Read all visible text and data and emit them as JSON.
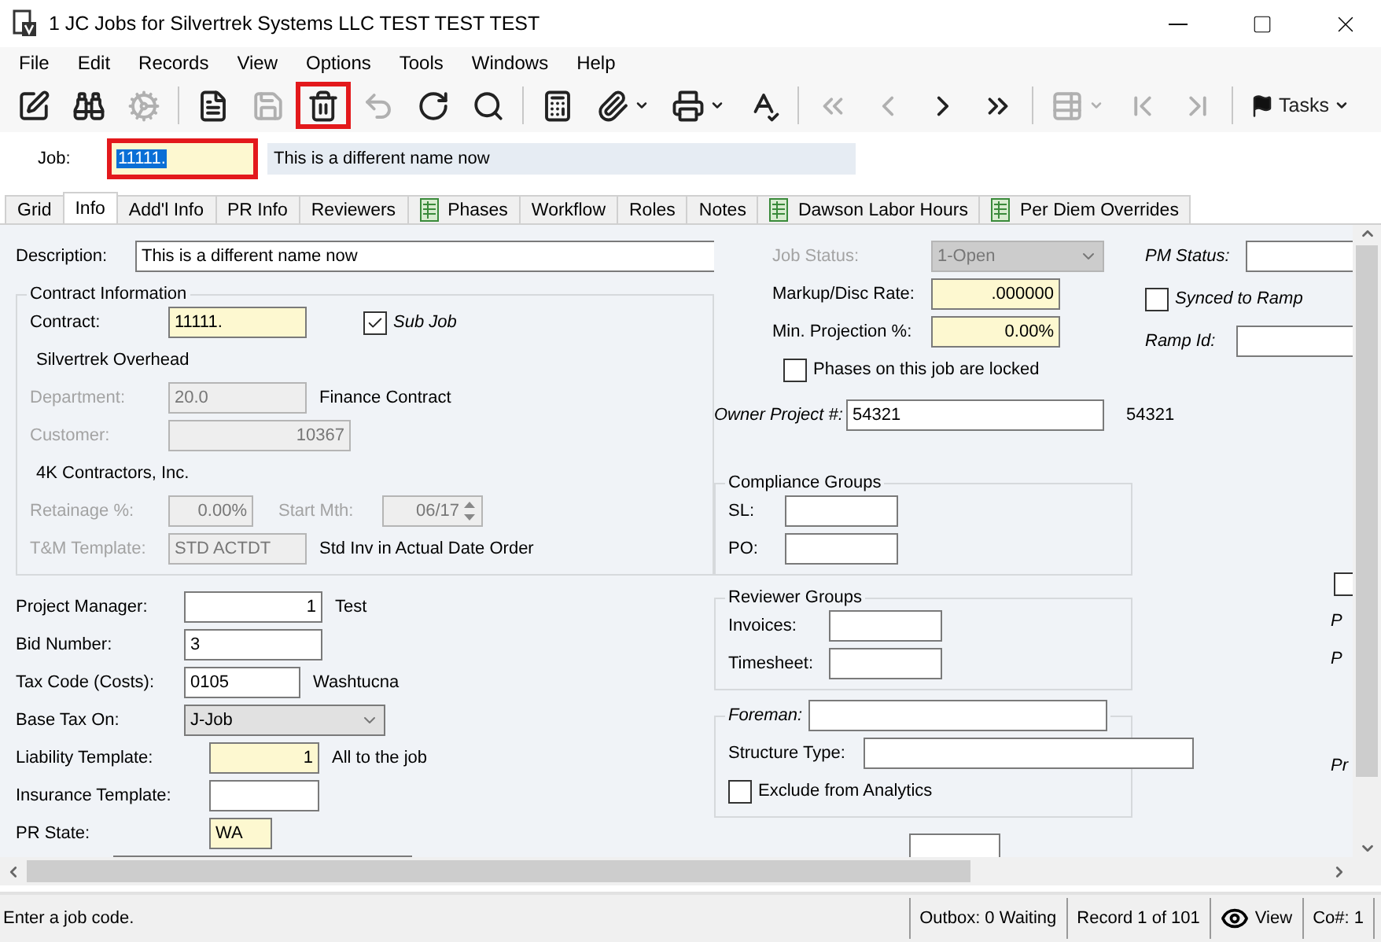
{
  "window": {
    "title": "1 JC Jobs for Silvertrek Systems LLC TEST TEST TEST"
  },
  "menu": [
    "File",
    "Edit",
    "Records",
    "View",
    "Options",
    "Tools",
    "Windows",
    "Help"
  ],
  "toolbar": [
    {
      "kind": "button",
      "disabled": false,
      "highlighted": false,
      "dropdown": false
    },
    {
      "kind": "button",
      "disabled": false,
      "highlighted": false,
      "dropdown": false
    },
    {
      "kind": "button",
      "disabled": true,
      "highlighted": false,
      "dropdown": false
    },
    {
      "kind": "separator"
    },
    {
      "kind": "button",
      "disabled": false,
      "highlighted": false,
      "dropdown": false
    },
    {
      "kind": "button",
      "disabled": true,
      "highlighted": false,
      "dropdown": false
    },
    {
      "kind": "button",
      "disabled": false,
      "highlighted": true,
      "dropdown": false
    },
    {
      "kind": "button",
      "disabled": true,
      "highlighted": false,
      "dropdown": false
    },
    {
      "kind": "button",
      "disabled": false,
      "highlighted": false,
      "dropdown": false
    },
    {
      "kind": "button",
      "disabled": false,
      "highlighted": false,
      "dropdown": false
    },
    {
      "kind": "separator"
    },
    {
      "kind": "button",
      "disabled": false,
      "highlighted": false,
      "dropdown": false
    },
    {
      "kind": "button",
      "disabled": false,
      "highlighted": false,
      "dropdown": true
    },
    {
      "kind": "button",
      "disabled": false,
      "highlighted": false,
      "dropdown": true
    },
    {
      "kind": "button",
      "disabled": false,
      "highlighted": false,
      "dropdown": false
    },
    {
      "kind": "separator"
    },
    {
      "kind": "button",
      "disabled": true,
      "highlighted": false,
      "dropdown": false
    },
    {
      "kind": "button",
      "disabled": true,
      "highlighted": false,
      "dropdown": false
    },
    {
      "kind": "button",
      "disabled": false,
      "highlighted": false,
      "dropdown": false
    },
    {
      "kind": "button",
      "disabled": false,
      "highlighted": false,
      "dropdown": false
    },
    {
      "kind": "separator"
    },
    {
      "kind": "button",
      "disabled": true,
      "highlighted": false,
      "dropdown": true
    },
    {
      "kind": "button",
      "disabled": true,
      "highlighted": false,
      "dropdown": false
    },
    {
      "kind": "button",
      "disabled": true,
      "highlighted": false,
      "dropdown": false
    },
    {
      "kind": "separator"
    },
    {
      "kind": "menu",
      "label": "Tasks",
      "dropdown": true
    }
  ],
  "job": {
    "label": "Job:",
    "value": "11111.",
    "text_selected": true,
    "highlighted": true,
    "name": "This is a different name now"
  },
  "tabs": [
    {
      "label": "Grid",
      "selected": false,
      "kind": "plain"
    },
    {
      "label": "Info",
      "selected": true,
      "kind": "plain"
    },
    {
      "label": "Add'l Info",
      "selected": false,
      "kind": "plain"
    },
    {
      "label": "PR Info",
      "selected": false,
      "kind": "plain"
    },
    {
      "label": "Reviewers",
      "selected": false,
      "kind": "plain"
    },
    {
      "label": "Phases",
      "selected": false,
      "kind": "grid"
    },
    {
      "label": "Workflow",
      "selected": false,
      "kind": "plain"
    },
    {
      "label": "Roles",
      "selected": false,
      "kind": "plain"
    },
    {
      "label": "Notes",
      "selected": false,
      "kind": "plain"
    },
    {
      "label": "Dawson Labor Hours",
      "selected": false,
      "kind": "grid"
    },
    {
      "label": "Per Diem Overrides",
      "selected": false,
      "kind": "grid"
    }
  ],
  "form": {
    "description": {
      "label": "Description:",
      "value": "This is a different name now",
      "kind": "text"
    },
    "contract_group": {
      "title": "Contract Information",
      "contract": {
        "label": "Contract:",
        "value": "11111.",
        "kind": "required"
      },
      "sub_job": {
        "label": "Sub Job",
        "checked": true
      },
      "contract_name": "Silvertrek Overhead",
      "department": {
        "label": "Department:",
        "value": "20.0",
        "kind": "readonly",
        "disabled": true,
        "note": "Finance Contract"
      },
      "customer": {
        "label": "Customer:",
        "value": "10367",
        "kind": "readonly",
        "disabled": true
      },
      "customer_name": "4K Contractors, Inc.",
      "retainage": {
        "label": "Retainage %:",
        "value": "0.00%",
        "kind": "readonly",
        "disabled": true
      },
      "start_month": {
        "label": "Start Mth:",
        "value": "06/17",
        "kind": "spinner",
        "disabled": true
      },
      "tm_template": {
        "label": "T&M Template:",
        "value": "STD ACTDT",
        "kind": "readonly",
        "disabled": true,
        "note": "Std Inv in Actual Date Order"
      }
    },
    "details": [
      {
        "label": "Project Manager:",
        "value": "1",
        "kind": "text",
        "note": "Test"
      },
      {
        "label": "Bid Number:",
        "value": "3",
        "kind": "text"
      },
      {
        "label": "Tax Code (Costs):",
        "value": "0105",
        "kind": "text",
        "note": "Washtucna"
      },
      {
        "label": "Base Tax On:",
        "value": "J-Job",
        "kind": "select"
      },
      {
        "label": "Liability Template:",
        "value": "1",
        "kind": "required",
        "note": "All to the job"
      },
      {
        "label": "Insurance Template:",
        "kind": "text"
      },
      {
        "label": "PR State:",
        "value": "WA",
        "kind": "required"
      }
    ],
    "partial_field": {
      "kind": "text"
    },
    "job_status": {
      "label": "Job Status:",
      "value": "1-Open",
      "kind": "select",
      "disabled": true
    },
    "markup_rate": {
      "label": "Markup/Disc Rate:",
      "value": ".000000",
      "kind": "required"
    },
    "min_projection": {
      "label": "Min. Projection %:",
      "value": "0.00%",
      "kind": "required"
    },
    "phases_locked": {
      "label": "Phases on this job are locked",
      "checked": false
    },
    "owner_project": {
      "label": "Owner Project #:",
      "value": "54321",
      "kind": "text",
      "note": "54321"
    },
    "compliance_group": {
      "title": "Compliance Groups",
      "fields": [
        {
          "label": "SL:",
          "kind": "text"
        },
        {
          "label": "PO:",
          "kind": "text"
        }
      ]
    },
    "reviewer_group": {
      "title": "Reviewer Groups",
      "fields": [
        {
          "label": "Invoices:",
          "kind": "text"
        },
        {
          "label": "Timesheet:",
          "kind": "text"
        }
      ]
    },
    "foreman": {
      "label": "Foreman:",
      "kind": "text"
    },
    "structure_type": {
      "label": "Structure Type:",
      "kind": "text"
    },
    "exclude_analytics": {
      "label": "Exclude from Analytics",
      "checked": false
    },
    "co_estimate_field": {
      "kind": "text"
    },
    "pm_status": {
      "label": "PM Status:",
      "kind": "text"
    },
    "synced_to_ramp": {
      "label": "Synced to Ramp",
      "checked": false
    },
    "ramp_id": {
      "label": "Ramp Id:",
      "kind": "text"
    },
    "cut_checkbox": {
      "checked": false
    },
    "cut_labels": [
      "P",
      "P",
      "Pr"
    ]
  },
  "status_bar": {
    "message": "Enter a job code.",
    "outbox": "Outbox: 0 Waiting",
    "record": "Record 1 of 101",
    "mode": "View",
    "company": "Co#: 1"
  }
}
